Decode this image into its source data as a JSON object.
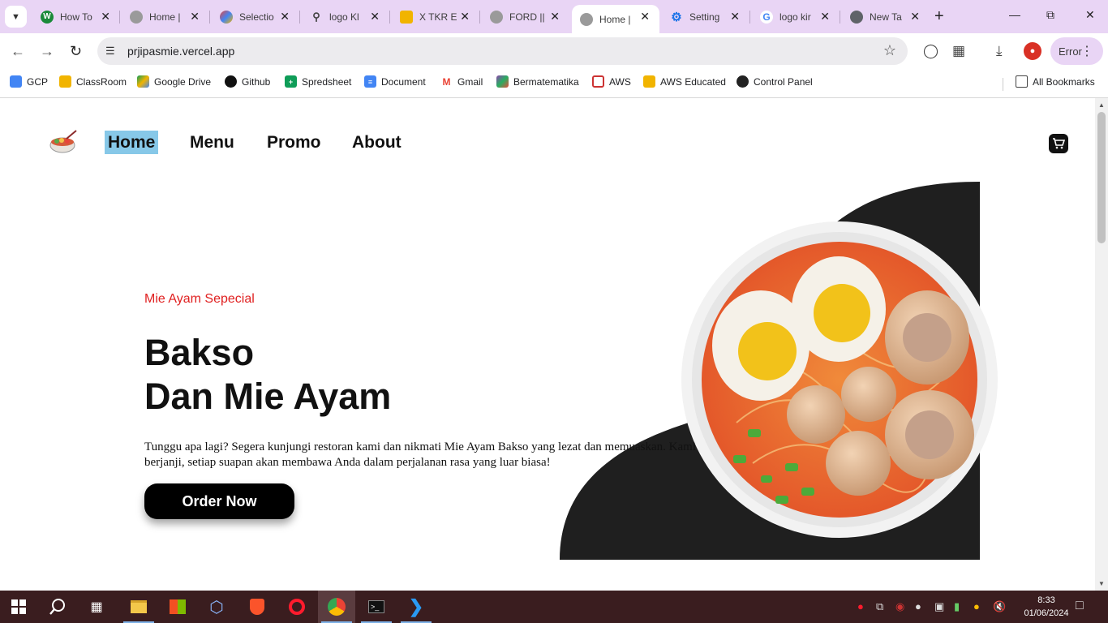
{
  "browser": {
    "tabs": [
      {
        "title": "How To",
        "favicon": "w-icon",
        "color": "#1a8a3a"
      },
      {
        "title": "Home |",
        "favicon": "globe-icon",
        "color": "#888888"
      },
      {
        "title": "Selectio",
        "favicon": "puzzle-icon",
        "color": "#e8453c"
      },
      {
        "title": "logo Kl",
        "favicon": "search-icon",
        "color": "#5f6368"
      },
      {
        "title": "X TKR E",
        "favicon": "classroom-icon",
        "color": "#f1b400"
      },
      {
        "title": "FORD ||",
        "favicon": "globe-icon",
        "color": "#888888"
      },
      {
        "title": "Home |",
        "favicon": "globe-icon",
        "color": "#888888"
      },
      {
        "title": "Setting",
        "favicon": "gear-icon",
        "color": "#1a73e8"
      },
      {
        "title": "logo kir",
        "favicon": "google-icon",
        "color": "#4285f4"
      },
      {
        "title": "New Ta",
        "favicon": "chrome-icon",
        "color": "#5f6368"
      }
    ],
    "url": "prjipasmie.vercel.app",
    "profile_status": "Error",
    "bookmarks": [
      {
        "label": "GCP",
        "color": "#4285f4"
      },
      {
        "label": "ClassRoom",
        "color": "#f1b400"
      },
      {
        "label": "Google Drive",
        "color": "#0f9d58"
      },
      {
        "label": "Github",
        "color": "#111111"
      },
      {
        "label": "Spredsheet",
        "color": "#0f9d58"
      },
      {
        "label": "Document",
        "color": "#4285f4"
      },
      {
        "label": "Gmail",
        "color": "#ea4335"
      },
      {
        "label": "Bermatematika",
        "color": "#8e44ad"
      },
      {
        "label": "AWS",
        "color": "#c44"
      },
      {
        "label": "AWS Educated",
        "color": "#f1b400"
      },
      {
        "label": "Control Panel",
        "color": "#222222"
      }
    ],
    "all_bookmarks": "All Bookmarks"
  },
  "page": {
    "nav": {
      "home": "Home",
      "menu": "Menu",
      "promo": "Promo",
      "about": "About"
    },
    "hero": {
      "subtitle": "Mie Ayam Sepecial",
      "title_line1": "Bakso",
      "title_line2": "Dan Mie Ayam",
      "description": "Tunggu apa lagi? Segera kunjungi restoran kami dan nikmati Mie Ayam Bakso yang lezat dan memuaskan. Kami berjanji, setiap suapan akan membawa Anda dalam perjalanan rasa yang luar biasa!",
      "cta": "Order Now"
    },
    "colors": {
      "accent_red": "#e02020",
      "nav_active": "#87c8e8",
      "dark": "#1f1f1f"
    }
  },
  "taskbar": {
    "time": "8:33",
    "date": "01/06/2024"
  }
}
